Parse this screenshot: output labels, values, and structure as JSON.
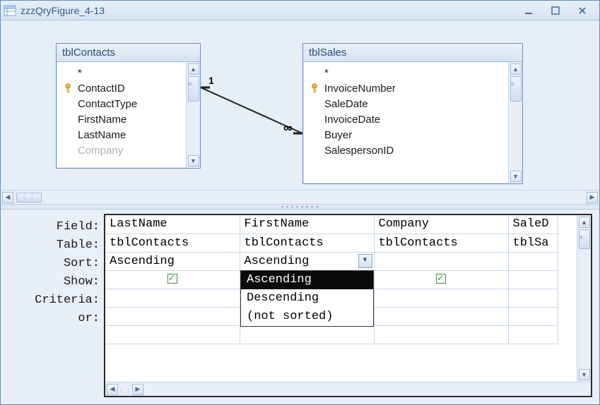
{
  "window": {
    "title": "zzzQryFigure_4-13"
  },
  "tables": {
    "left": {
      "name": "tblContacts",
      "fields": [
        "*",
        "ContactID",
        "ContactType",
        "FirstName",
        "LastName",
        "Company"
      ],
      "pk_index": 1
    },
    "right": {
      "name": "tblSales",
      "fields": [
        "*",
        "InvoiceNumber",
        "SaleDate",
        "InvoiceDate",
        "Buyer",
        "SalespersonID"
      ],
      "pk_index": 1
    }
  },
  "relationship": {
    "left_label": "1",
    "right_label": "∞"
  },
  "grid": {
    "row_labels": [
      "Field:",
      "Table:",
      "Sort:",
      "Show:",
      "Criteria:",
      "or:"
    ],
    "columns": [
      {
        "field": "LastName",
        "table": "tblContacts",
        "sort": "Ascending",
        "show": true,
        "criteria": "",
        "or": ""
      },
      {
        "field": "FirstName",
        "table": "tblContacts",
        "sort": "Ascending",
        "show": true,
        "criteria": "",
        "or": ""
      },
      {
        "field": "Company",
        "table": "tblContacts",
        "sort": "",
        "show": true,
        "criteria": "",
        "or": ""
      },
      {
        "field": "SaleD",
        "table": "tblSa",
        "sort": "",
        "show": null,
        "criteria": "",
        "or": ""
      }
    ],
    "sort_dropdown": {
      "open_on_column": 1,
      "options": [
        "Ascending",
        "Descending",
        "(not sorted)"
      ],
      "selected": "Ascending"
    }
  }
}
